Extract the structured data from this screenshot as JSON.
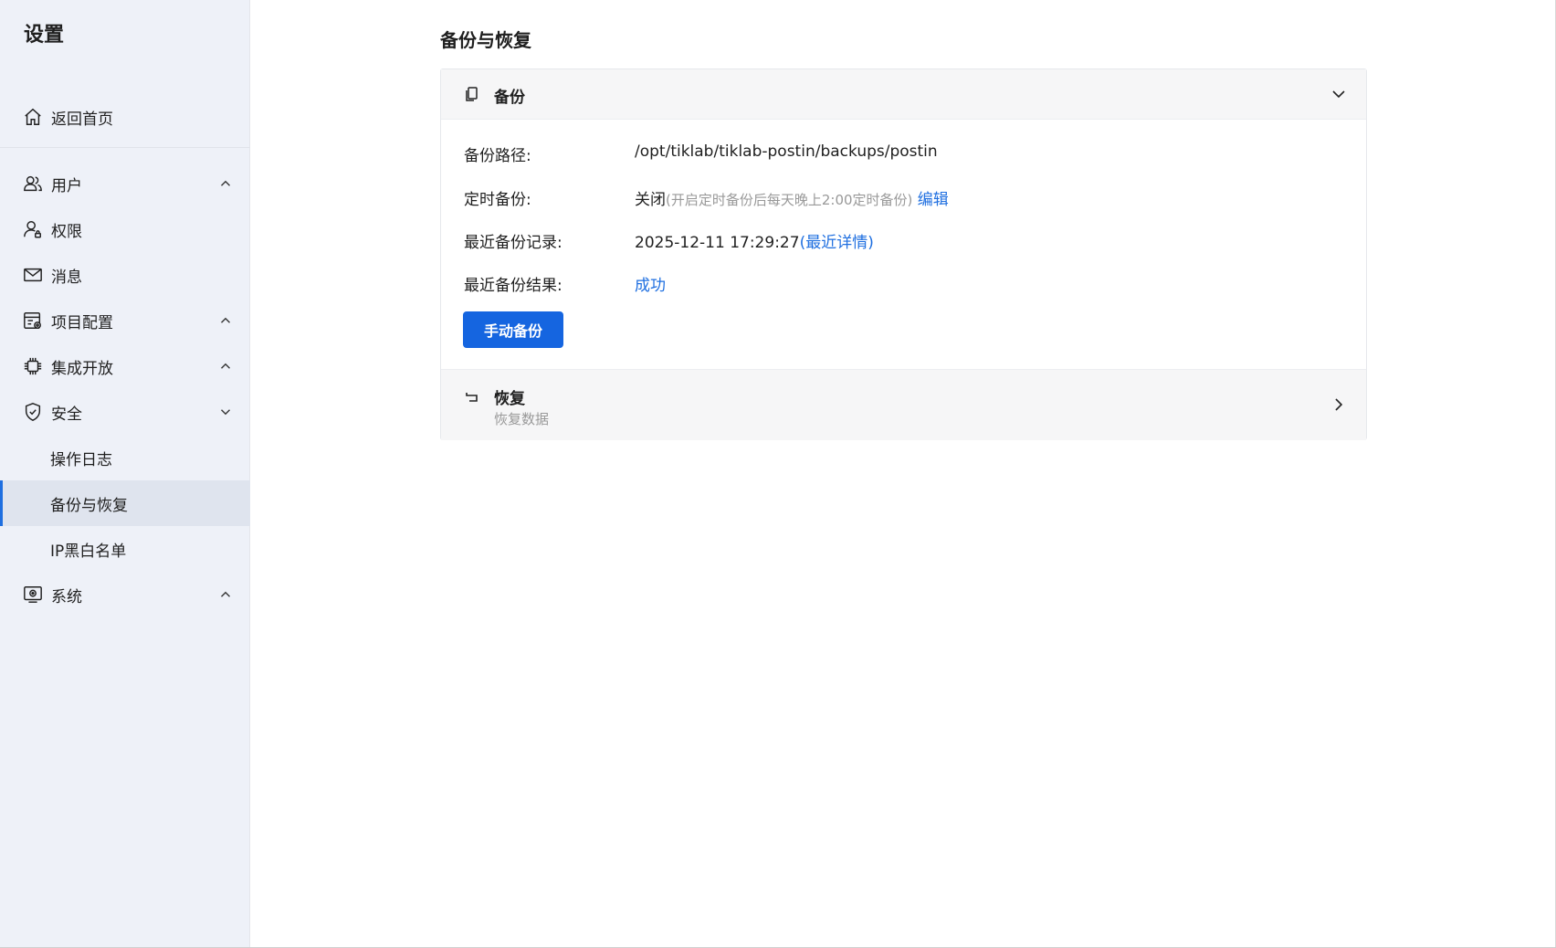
{
  "sidebar": {
    "title": "设置",
    "items": [
      {
        "label": "返回首页",
        "icon": "home-icon"
      },
      {
        "label": "用户",
        "icon": "users-icon",
        "chevron": "up"
      },
      {
        "label": "权限",
        "icon": "user-lock-icon"
      },
      {
        "label": "消息",
        "icon": "mail-icon"
      },
      {
        "label": "项目配置",
        "icon": "project-config-icon",
        "chevron": "up"
      },
      {
        "label": "集成开放",
        "icon": "chip-icon",
        "chevron": "up"
      },
      {
        "label": "安全",
        "icon": "shield-icon",
        "chevron": "down"
      },
      {
        "label": "操作日志"
      },
      {
        "label": "备份与恢复",
        "active": true
      },
      {
        "label": "IP黑白名单"
      },
      {
        "label": "系统",
        "icon": "monitor-icon",
        "chevron": "up"
      }
    ]
  },
  "main": {
    "title": "备份与恢复",
    "backup": {
      "label": "备份",
      "path_label": "备份路径:",
      "path_value": "/opt/tiklab/tiklab-postin/backups/postin",
      "schedule_label": "定时备份:",
      "schedule_value": "关闭",
      "schedule_note": "(开启定时备份后每天晚上2:00定时备份)",
      "schedule_edit": "编辑",
      "last_label": "最近备份记录:",
      "last_value": "2025-12-11 17:29:27",
      "last_detail": "(最近详情)",
      "result_label": "最近备份结果:",
      "result_value": "成功",
      "manual_button": "手动备份"
    },
    "restore": {
      "label": "恢复",
      "sub": "恢复数据"
    }
  },
  "colors": {
    "accent": "#1565e0",
    "link": "#1f6fe0",
    "sidebar_bg": "#eef1f8",
    "active_bg": "#dfe4ee"
  }
}
